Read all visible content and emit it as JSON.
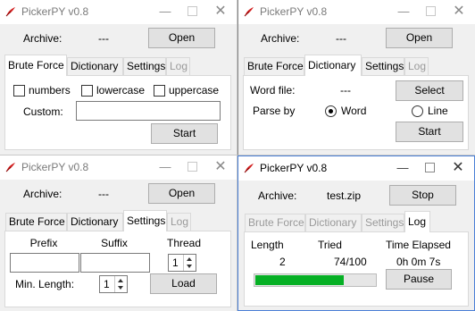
{
  "app": {
    "title": "PickerPY v0.8"
  },
  "tabs": {
    "brute": "Brute Force",
    "dict": "Dictionary",
    "settings": "Settings",
    "log": "Log"
  },
  "common": {
    "archive_label": "Archive:",
    "open": "Open",
    "start": "Start",
    "stop": "Stop"
  },
  "w0": {
    "archive_value": "---",
    "brute": {
      "numbers": "numbers",
      "lowercase": "lowercase",
      "uppercase": "uppercase",
      "custom_label": "Custom:",
      "custom_value": ""
    }
  },
  "w1": {
    "archive_value": "---",
    "dict": {
      "word_file_label": "Word file:",
      "word_file_value": "---",
      "select": "Select",
      "parse_by_label": "Parse by",
      "word_option": "Word",
      "line_option": "Line",
      "selected": "Word"
    }
  },
  "w2": {
    "archive_value": "---",
    "settings": {
      "prefix_label": "Prefix",
      "suffix_label": "Suffix",
      "thread_label": "Thread",
      "thread_value": "1",
      "min_length_label": "Min. Length:",
      "min_length_value": "1",
      "load": "Load"
    }
  },
  "w3": {
    "archive_value": "test.zip",
    "log": {
      "length_label": "Length",
      "tried_label": "Tried",
      "elapsed_label": "Time Elapsed",
      "length_value": "2",
      "tried_value": "74/100",
      "elapsed_value": "0h 0m 7s",
      "pause": "Pause",
      "progress": 0.74
    }
  },
  "colors": {
    "progress": "#06b025",
    "titlebar_text": "#7a7a7a",
    "active_border": "#4a7fd6"
  },
  "icons": {
    "app": "tk-feather-icon",
    "minimize": "minimize-icon",
    "maximize": "maximize-icon",
    "close": "close-icon"
  }
}
